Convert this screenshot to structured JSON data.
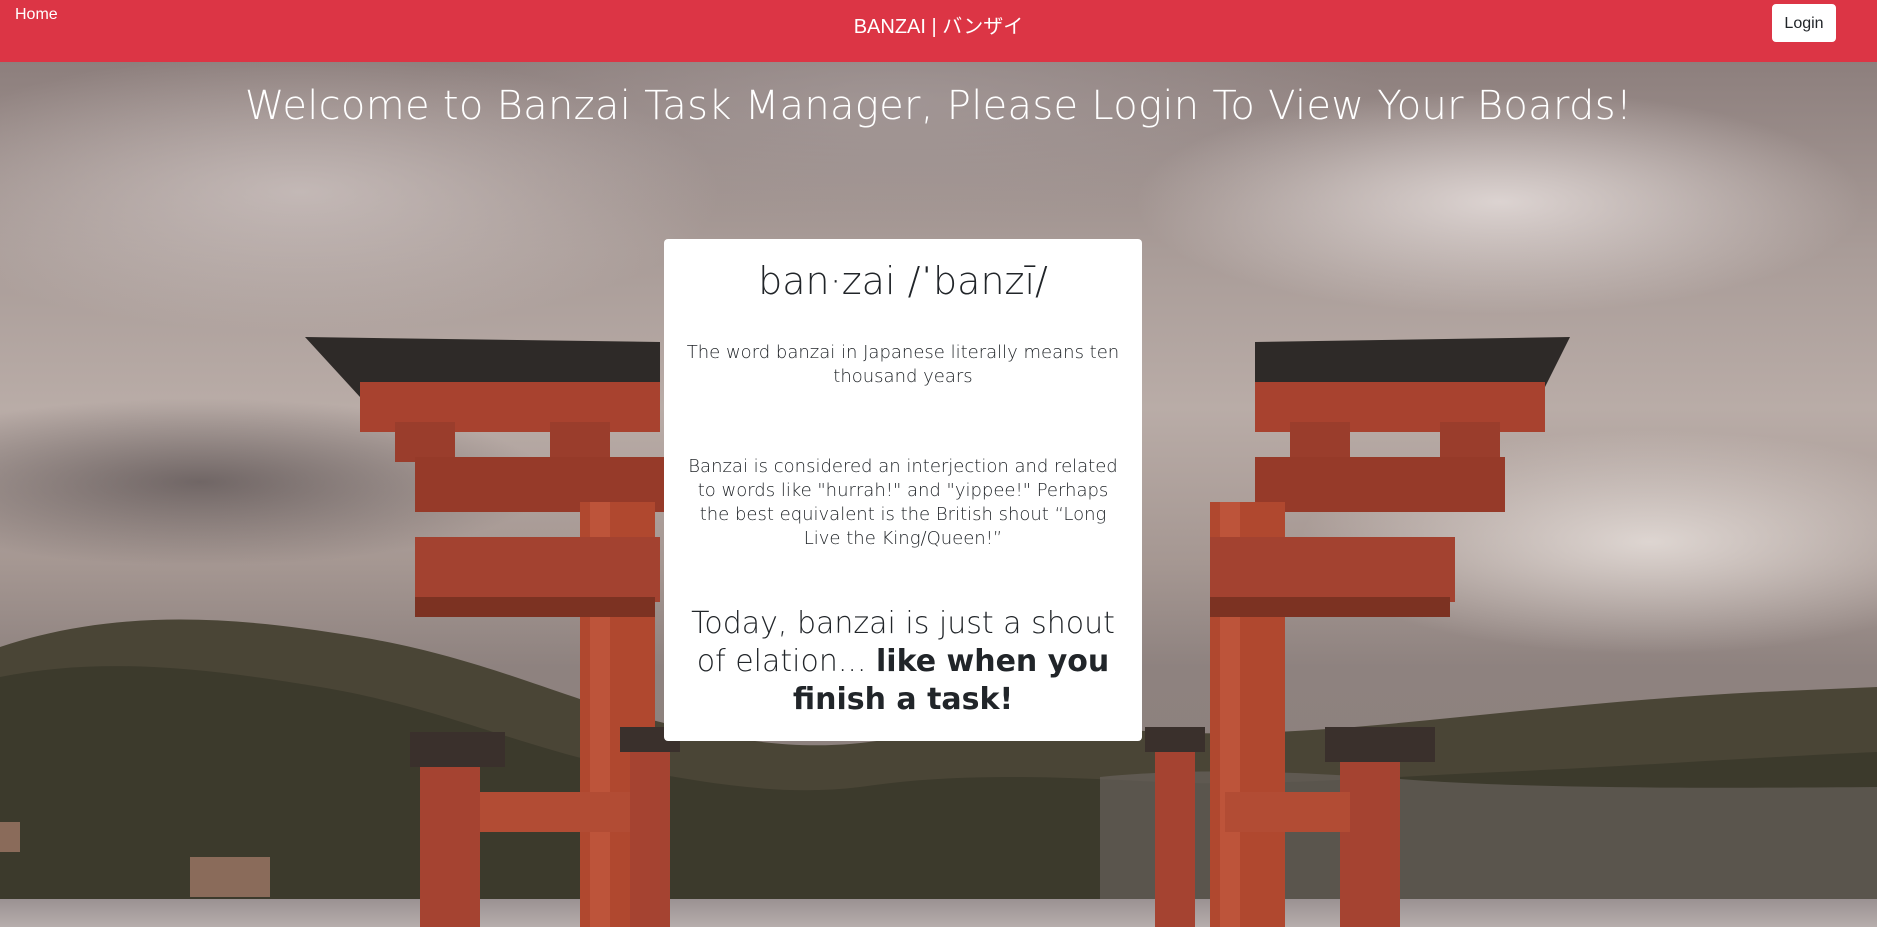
{
  "navbar": {
    "home_label": "Home",
    "brand": "BANZAI | バンザイ",
    "login_label": "Login",
    "color": "#dc3545"
  },
  "hero": {
    "headline": "Welcome to Banzai Task Manager, Please Login To View Your Boards!"
  },
  "card": {
    "title": "ban·zai /ˈbanzī/",
    "paragraph1": "The word banzai in Japanese literally means ten thousand years",
    "paragraph2": "Banzai is considered an interjection and related to words like \"hurrah!\" and \"yippee!\" Perhaps the best equivalent is the British shout “Long Live the King/Queen!”",
    "paragraph3_lead": "Today, banzai is just a shout of elation... ",
    "paragraph3_emphasis": "like when you finish a task!"
  },
  "background": {
    "scene": "torii gate over a lake with cloudy sky",
    "torii_color": "#b84a34"
  }
}
